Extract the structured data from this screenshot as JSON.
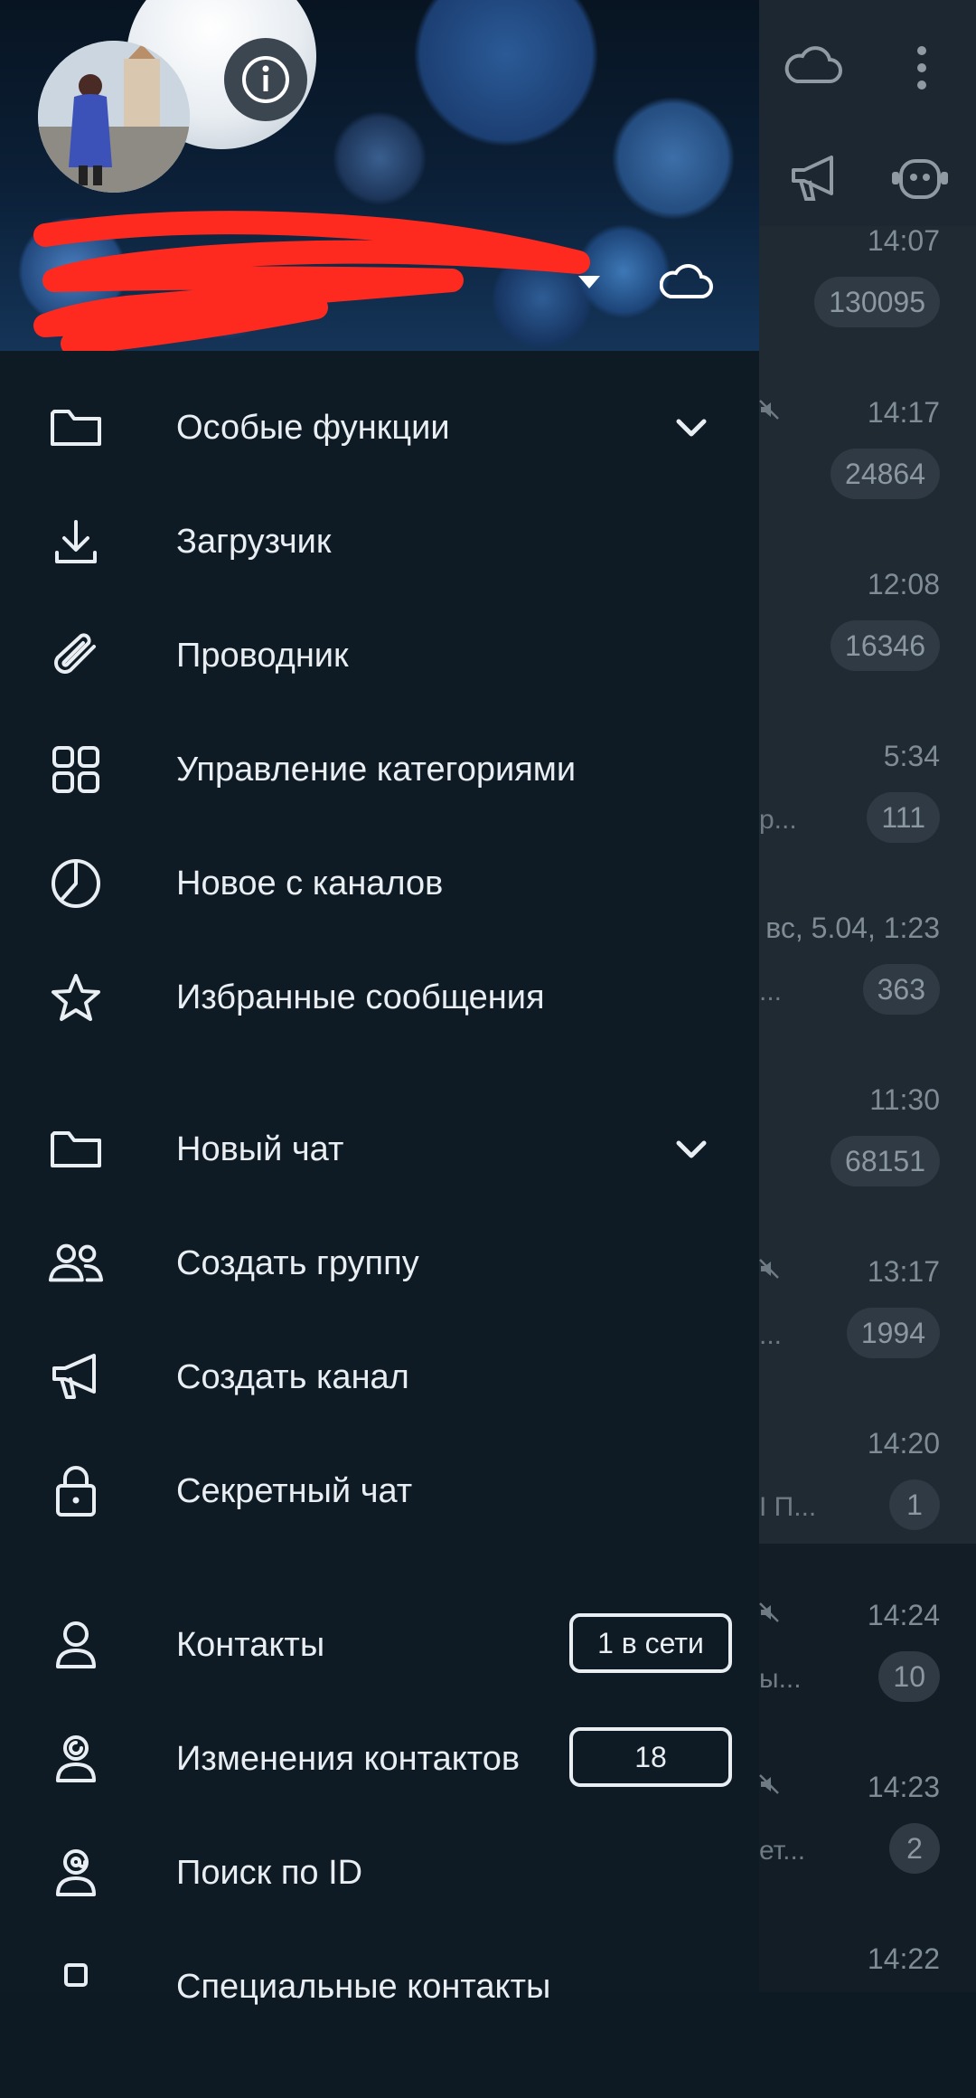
{
  "background": {
    "rows": [
      {
        "time": "14:07",
        "badge": "130095",
        "snippet": "",
        "muted": false
      },
      {
        "time": "14:17",
        "badge": "24864",
        "snippet": "",
        "muted": true
      },
      {
        "time": "12:08",
        "badge": "16346",
        "snippet": "",
        "muted": false
      },
      {
        "time": "5:34",
        "badge": "111",
        "snippet": "р...",
        "muted": false
      },
      {
        "time": "вс, 5.04, 1:23",
        "badge": "363",
        "snippet": "...",
        "muted": false
      },
      {
        "time": "11:30",
        "badge": "68151",
        "snippet": "",
        "muted": false
      },
      {
        "time": "13:17",
        "badge": "1994",
        "snippet": "...",
        "muted": true
      },
      {
        "time": "14:20",
        "badge": "1",
        "snippet": "I П...",
        "muted": false
      },
      {
        "time": "14:24",
        "badge": "10",
        "snippet": "ы...",
        "muted": true
      },
      {
        "time": "14:23",
        "badge": "2",
        "snippet": "ет...",
        "muted": true
      },
      {
        "time": "14:22",
        "badge": "",
        "snippet": "",
        "muted": false
      }
    ]
  },
  "menu": {
    "group1": [
      {
        "label": "Особые функции",
        "icon": "folder-icon",
        "expandable": true
      },
      {
        "label": "Загрузчик",
        "icon": "download-icon"
      },
      {
        "label": "Проводник",
        "icon": "paperclip-icon"
      },
      {
        "label": "Управление категориями",
        "icon": "grid-icon"
      },
      {
        "label": "Новое с каналов",
        "icon": "clock-icon"
      },
      {
        "label": "Избранные сообщения",
        "icon": "star-icon"
      }
    ],
    "group2": [
      {
        "label": "Новый чат",
        "icon": "folder-icon",
        "expandable": true
      },
      {
        "label": "Создать группу",
        "icon": "group-icon"
      },
      {
        "label": "Создать канал",
        "icon": "megaphone-icon"
      },
      {
        "label": "Секретный чат",
        "icon": "lock-icon"
      }
    ],
    "group3": [
      {
        "label": "Контакты",
        "icon": "person-icon",
        "pill": "1 в сети"
      },
      {
        "label": "Изменения контактов",
        "icon": "person-change-icon",
        "pill": "18"
      },
      {
        "label": "Поиск по ID",
        "icon": "person-at-icon"
      },
      {
        "label": "Специальные контакты",
        "icon": "special-contact-icon"
      }
    ]
  },
  "colors": {
    "drawer": "#0e1a24",
    "text": "#e9eef3",
    "background_list": "#1f2a33"
  }
}
